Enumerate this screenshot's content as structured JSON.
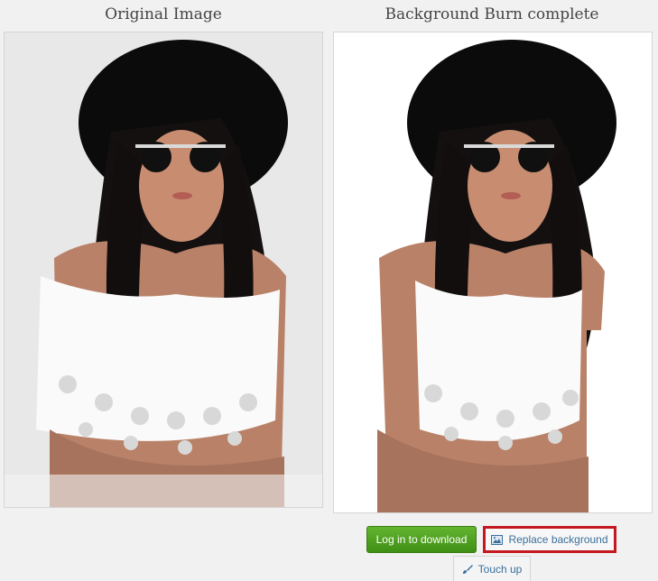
{
  "panels": {
    "left_title": "Original Image",
    "right_title": "Background Burn complete"
  },
  "actions": {
    "download_label": "Log in to download",
    "replace_label": "Replace background",
    "touch_label": "Touch up"
  },
  "colors": {
    "download_button": "#4f9f22",
    "highlight_border": "#c4171f",
    "link_text": "#3a6f9b",
    "page_background": "#f1f1f1"
  },
  "icons": {
    "replace": "image-icon",
    "touch": "brush-icon"
  }
}
